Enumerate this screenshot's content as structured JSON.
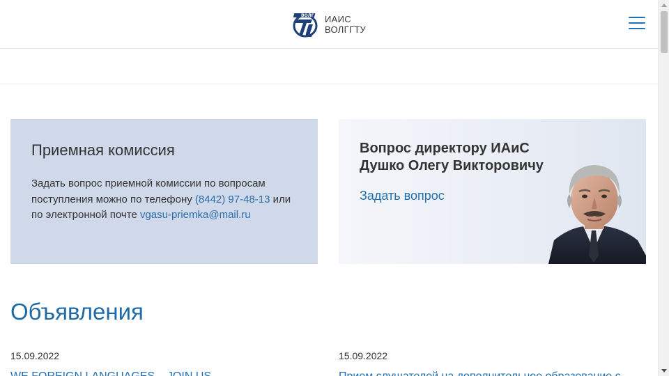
{
  "header": {
    "logo_text_line1": "ИАИС",
    "logo_text_line2": "ВОЛГГТУ",
    "logo_mark_text": "ВОЛГ",
    "menu_icon": "hamburger-icon"
  },
  "admission": {
    "title": "Приемная комиссия",
    "text_part1": "Задать вопрос приемной комиссии по вопросам поступления можно по телефону ",
    "phone": "(8442) 97-48-13",
    "text_part2": " или по электронной почте ",
    "email": "vgasu-priemka@mail.ru"
  },
  "director": {
    "title_line1": "Вопрос директору ИАиС",
    "title_line2": "Душко Олегу Викторовичу",
    "link": "Задать вопрос"
  },
  "announcements": {
    "title": "Объявления",
    "items": [
      {
        "date": "15.09.2022",
        "title": "WE FOREIGN LANGUAGES – JOIN US"
      },
      {
        "date": "15.09.2022",
        "title": "Прием слушателей на дополнительное образование с"
      }
    ]
  },
  "colors": {
    "accent": "#1f6fb0",
    "admission_bg": "#d0d9ea",
    "director_bg": "#eef1f7"
  }
}
